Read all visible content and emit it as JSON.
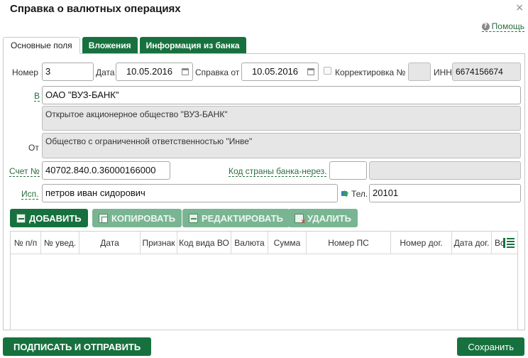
{
  "dialog": {
    "title": "Справка о валютных операциях",
    "close": "×",
    "help": "Помощь",
    "help_icon": "?"
  },
  "tabs": [
    {
      "label": "Основные поля",
      "active": true
    },
    {
      "label": "Вложения",
      "active": false
    },
    {
      "label": "Информация из банка",
      "active": false
    }
  ],
  "form": {
    "number_label": "Номер",
    "number_value": "3",
    "date_label": "Дата",
    "date_value": "10.05.2016",
    "ref_date_label": "Справка от",
    "ref_date_value": "10.05.2016",
    "correction_label": "Корректировка №",
    "correction_value": "",
    "inn_label": "ИНН",
    "inn_value": "6674156674",
    "to_label": "В",
    "to_value": "ОАО \"ВУЗ-БАНК\"",
    "to_fullname": "Открытое акционерное общество \"ВУЗ-БАНК\"",
    "from_label": "От",
    "from_value": "Общество с ограниченной ответственностью \"Инве\"",
    "account_label": "Счет №",
    "account_value": "40702.840.0.36000166000",
    "country_code_label": "Код страны банка-нерез.",
    "country_code_value": "",
    "country_name_value": "",
    "executor_label": "Исп.",
    "executor_value": "петров иван сидорович",
    "phone_label": "Тел.",
    "phone_value": "20101"
  },
  "toolbar": {
    "add": "ДОБАВИТЬ",
    "copy": "КОПИРОВАТЬ",
    "edit": "РЕДАКТИРОВАТЬ",
    "delete": "УДАЛИТЬ"
  },
  "grid": {
    "columns": [
      "№ п/п",
      "№ увед.",
      "Дата",
      "Признак",
      "Код вида ВО",
      "Валюта",
      "Сумма",
      "Номер ПС",
      "Номер дог.",
      "Дата дог.",
      "Вс"
    ],
    "rows": []
  },
  "footer": {
    "sign_send": "ПОДПИСАТЬ И ОТПРАВИТЬ",
    "save": "Сохранить"
  },
  "colors": {
    "accent": "#17713e",
    "disabled": "#79b592",
    "readonly_bg": "#e6e6e6"
  }
}
